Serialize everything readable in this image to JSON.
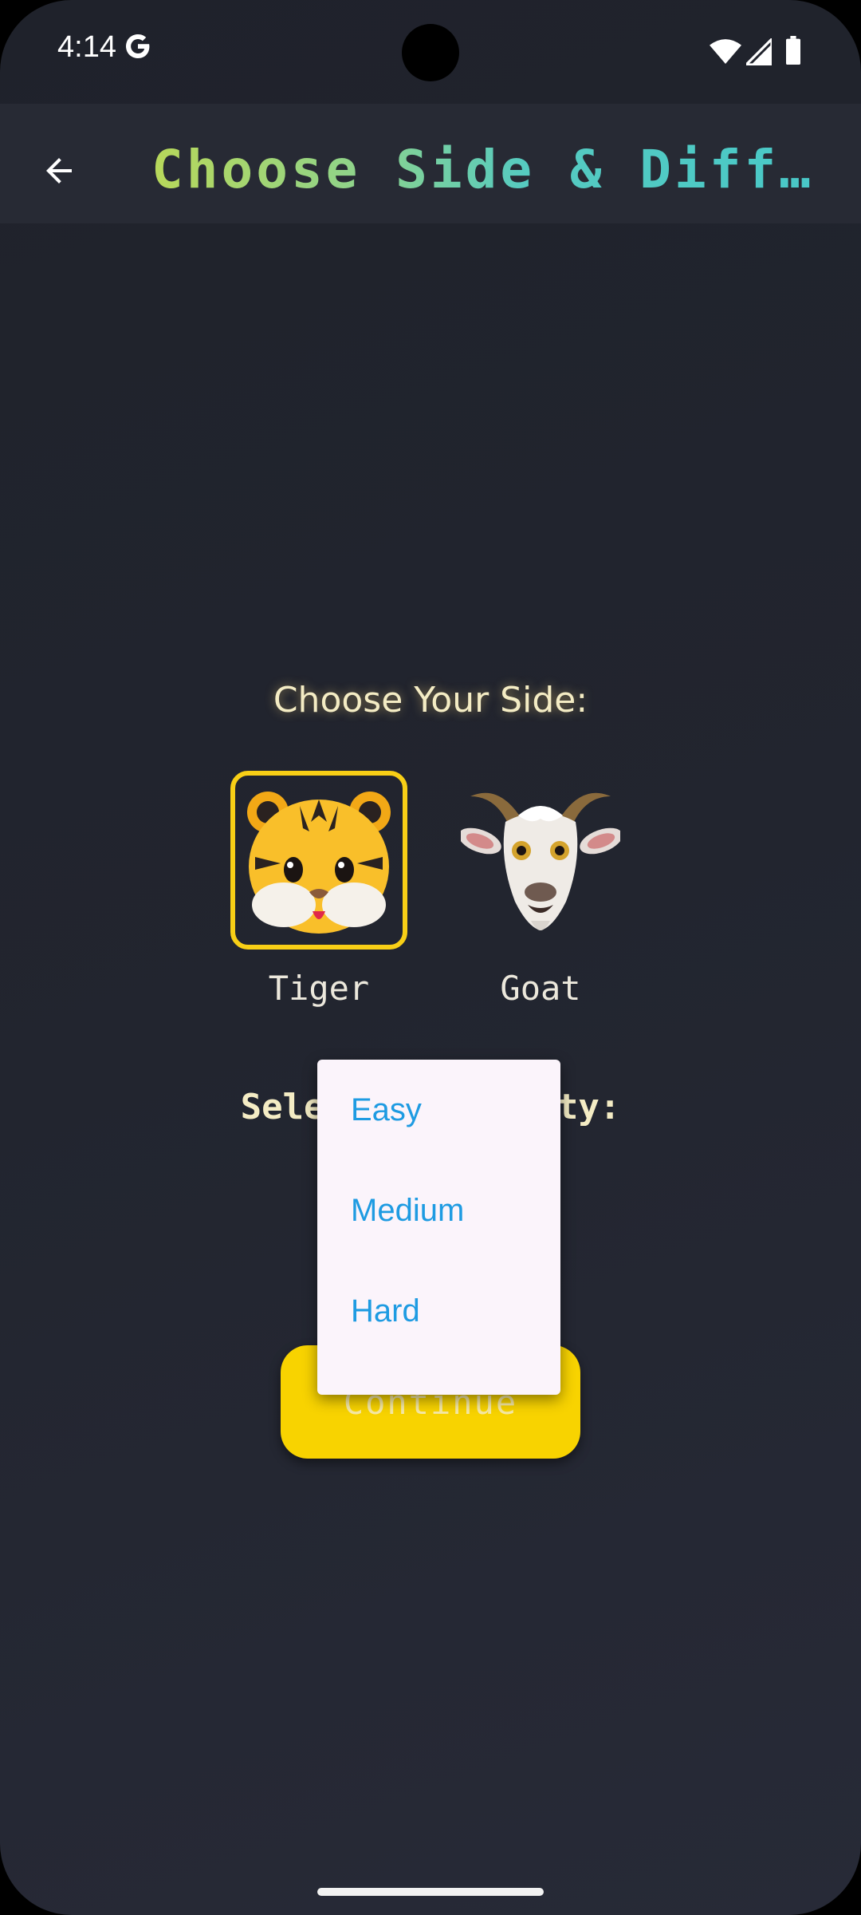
{
  "status_bar": {
    "time": "4:14",
    "icons": [
      "google-g-icon",
      "wifi-icon",
      "signal-icon",
      "battery-icon"
    ]
  },
  "app_bar": {
    "back_icon": "arrow-back-icon",
    "title": "Choose Side & Diff…"
  },
  "side_section": {
    "heading": "Choose Your Side:",
    "options": [
      {
        "label": "Tiger",
        "emoji": "🐯",
        "selected": true
      },
      {
        "label": "Goat",
        "emoji": "🐐",
        "selected": false
      }
    ]
  },
  "difficulty_section": {
    "heading": "Select Difficulty:"
  },
  "continue_button": {
    "label": "Continue"
  },
  "difficulty_menu": {
    "items": [
      "Easy",
      "Medium",
      "Hard"
    ]
  },
  "colors": {
    "accent_yellow": "#f8d300",
    "menu_text": "#1e9be2",
    "background": "#22252f"
  }
}
